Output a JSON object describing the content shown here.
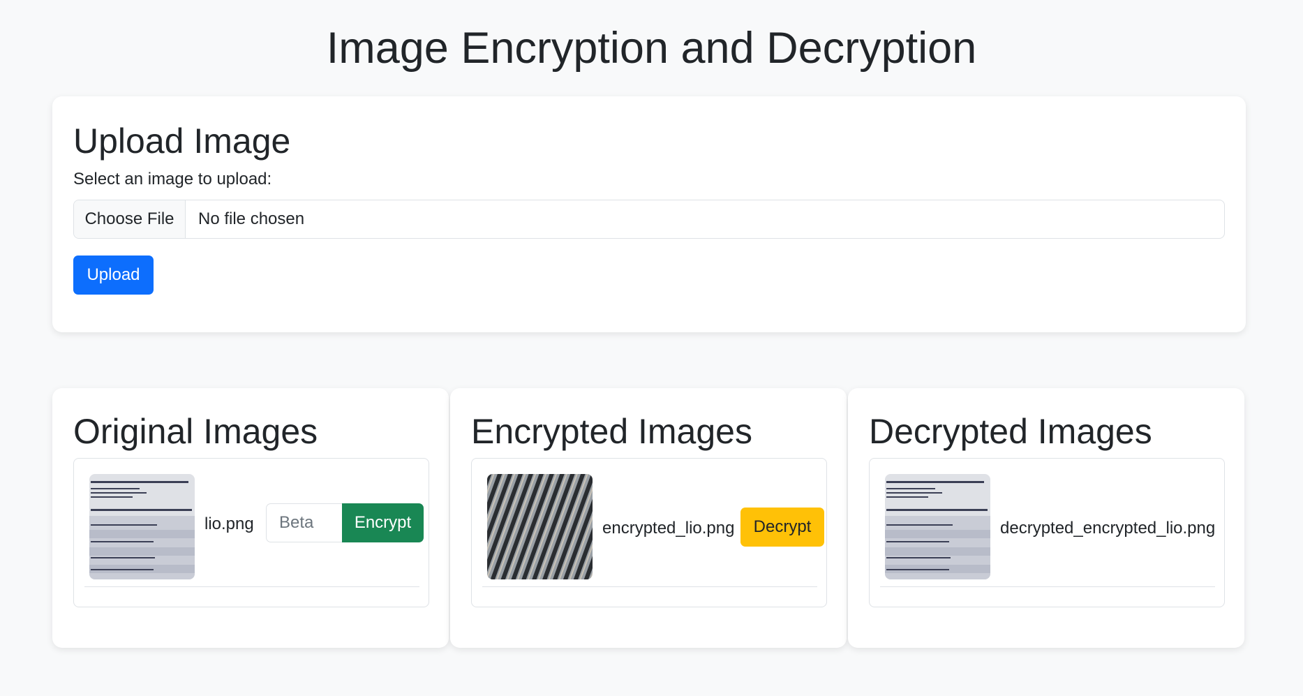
{
  "page": {
    "title": "Image Encryption and Decryption"
  },
  "upload": {
    "heading": "Upload Image",
    "label": "Select an image to upload:",
    "choose_file": "Choose File",
    "file_status": "No file chosen",
    "upload_button": "Upload"
  },
  "original": {
    "heading": "Original Images",
    "items": [
      {
        "filename": "lio.png",
        "beta_placeholder": "Beta",
        "encrypt_label": "Encrypt"
      }
    ]
  },
  "encrypted": {
    "heading": "Encrypted Images",
    "items": [
      {
        "filename": "encrypted_lio.png",
        "decrypt_label": "Decrypt"
      }
    ]
  },
  "decrypted": {
    "heading": "Decrypted Images",
    "items": [
      {
        "filename": "decrypted_encrypted_lio.png"
      }
    ]
  },
  "colors": {
    "primary": "#0d6efd",
    "success": "#198754",
    "warning": "#ffc107",
    "background": "#f8f9fa"
  }
}
